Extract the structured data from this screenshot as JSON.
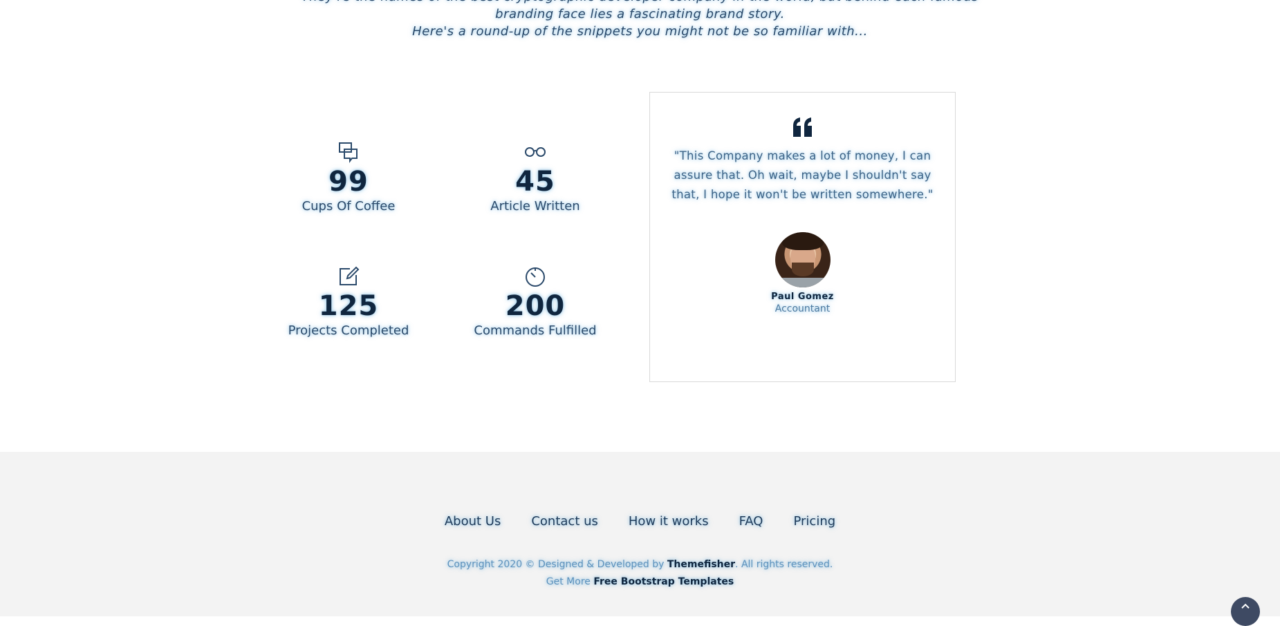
{
  "intro": {
    "line1": "They're the names of the best cryptographic developer company in the world, but behind each famous",
    "line2": "branding face lies a fascinating brand story.",
    "line3": "Here's a round-up of the snippets you might not be so familiar with..."
  },
  "stats": [
    {
      "icon": "chat-bubbles-icon",
      "value": "99",
      "label": "Cups Of Coffee"
    },
    {
      "icon": "glasses-icon",
      "value": "45",
      "label": "Article Written"
    },
    {
      "icon": "edit-icon",
      "value": "125",
      "label": "Projects Completed"
    },
    {
      "icon": "timer-icon",
      "value": "200",
      "label": "Commands Fulfilled"
    }
  ],
  "testimonial": {
    "quote": "\"This Company makes a lot of money, I can assure that. Oh wait, maybe I shouldn't say that, I hope it won't be written somewhere.\"",
    "name": "Paul Gomez",
    "role": "Accountant"
  },
  "footer": {
    "nav": [
      "About Us",
      "Contact us",
      "How it works",
      "FAQ",
      "Pricing"
    ],
    "copyright_prefix": "Copyright 2020 © Designed & Developed by ",
    "copyright_link": "Themefisher",
    "copyright_suffix": ". All rights reserved.",
    "more_prefix": "Get More ",
    "more_link": "Free Bootstrap Templates"
  },
  "colors": {
    "text_dark": "#10263f",
    "text_mid": "#2b4a6b",
    "text_light": "#5d92bd",
    "footer_bg": "#f3f3f3",
    "scroll_button": "#3e4a63"
  }
}
